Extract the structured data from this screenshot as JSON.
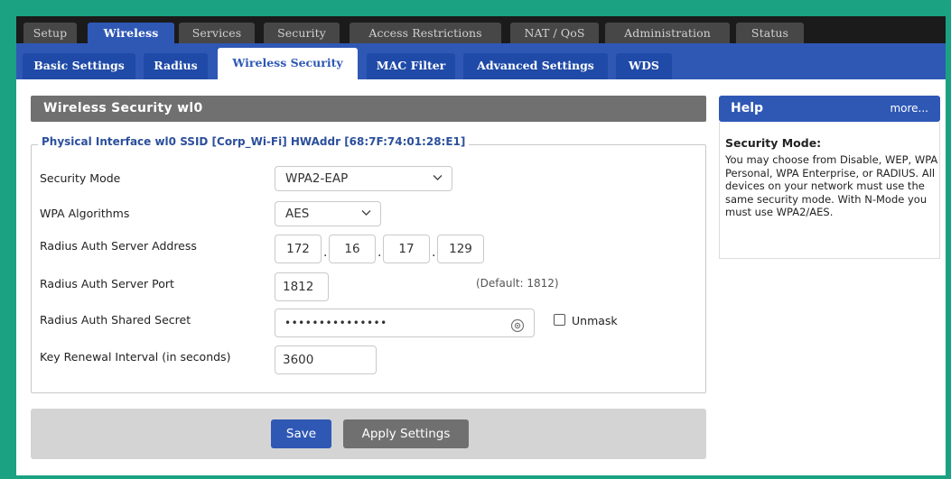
{
  "tabs": [
    "Setup",
    "Wireless",
    "Services",
    "Security",
    "Access Restrictions",
    "NAT / QoS",
    "Administration",
    "Status"
  ],
  "active_tab": "Wireless",
  "subtabs": [
    "Basic Settings",
    "Radius",
    "Wireless Security",
    "MAC Filter",
    "Advanced Settings",
    "WDS"
  ],
  "active_subtab": "Wireless Security",
  "section": {
    "title": "Wireless Security wl0",
    "legend": "Physical Interface wl0 SSID [Corp_Wi-Fi] HWAddr [68:7F:74:01:28:E1]"
  },
  "form": {
    "security_mode": {
      "label": "Security Mode",
      "value": "WPA2-EAP"
    },
    "wpa_algorithms": {
      "label": "WPA Algorithms",
      "value": "AES"
    },
    "radius_address": {
      "label": "Radius Auth Server Address",
      "octets": [
        "172",
        "16",
        "17",
        "129"
      ]
    },
    "radius_port": {
      "label": "Radius Auth Server Port",
      "value": "1812",
      "default_hint": "(Default: 1812)"
    },
    "shared_secret": {
      "label": "Radius Auth Shared Secret",
      "value": "•••••••••••••••",
      "unmask_label": "Unmask",
      "unmask_checked": false
    },
    "key_renewal": {
      "label": "Key Renewal Interval (in seconds)",
      "value": "3600"
    }
  },
  "buttons": {
    "save": "Save",
    "apply": "Apply Settings"
  },
  "help": {
    "title": "Help",
    "more": "more...",
    "heading": "Security Mode:",
    "text": "You may choose from Disable, WEP, WPA Personal, WPA Enterprise, or RADIUS. All devices on your network must use the same security mode. With N-Mode you must use WPA2/AES."
  },
  "colors": {
    "accent": "#2f58b5",
    "tab_bg": "#474747",
    "section_header": "#707070",
    "frame": "#1aa282"
  },
  "icons": {
    "dropdown": "chevron-down-icon",
    "secret": "eye-icon"
  }
}
